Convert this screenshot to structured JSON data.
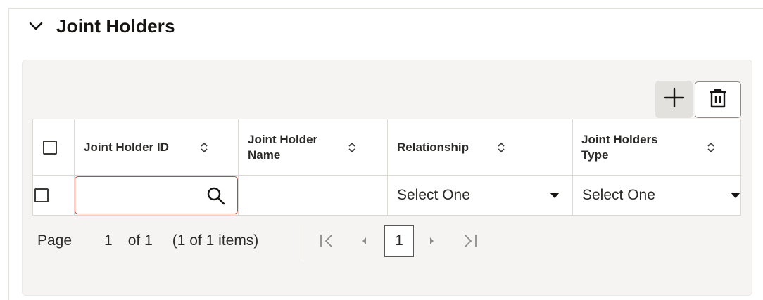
{
  "section": {
    "title": "Joint Holders"
  },
  "toolbar": {
    "add_icon": "plus-icon",
    "delete_icon": "trash-icon"
  },
  "grid": {
    "columns": [
      {
        "label": "Joint Holder ID"
      },
      {
        "label": "Joint Holder Name"
      },
      {
        "label": "Relationship"
      },
      {
        "label": "Joint Holders Type"
      }
    ],
    "rows": [
      {
        "joint_holder_id": "",
        "joint_holder_name": "",
        "relationship": "Select One",
        "joint_holders_type": "Select One"
      }
    ]
  },
  "pager": {
    "page_label": "Page",
    "page_number": "1",
    "of_pages": "of 1",
    "items_summary": "(1 of 1 items)",
    "current_page": "1"
  },
  "colors": {
    "accent_border": "#c74634",
    "panel_bg": "#f5f4f2",
    "add_button_bg": "#e3e1de"
  }
}
